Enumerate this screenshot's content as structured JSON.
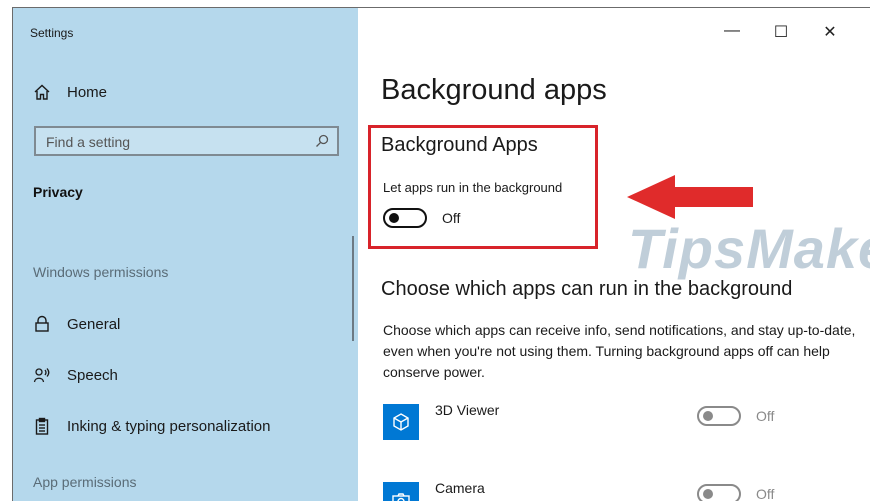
{
  "window": {
    "title": "Settings",
    "controls": {
      "minimize": "—",
      "maximize": "☐",
      "close": "✕"
    }
  },
  "sidebar": {
    "home_label": "Home",
    "search_placeholder": "Find a setting",
    "current_section": "Privacy",
    "windows_permissions_label": "Windows permissions",
    "items": [
      {
        "label": "General",
        "icon": "lock-icon"
      },
      {
        "label": "Speech",
        "icon": "speech-icon"
      },
      {
        "label": "Inking & typing personalization",
        "icon": "clipboard-icon"
      }
    ],
    "app_permissions_label": "App permissions"
  },
  "main": {
    "page_title": "Background apps",
    "section_title": "Background Apps",
    "toggle_label": "Let apps run in the background",
    "toggle_state": "Off",
    "choose_title": "Choose which apps can run in the background",
    "choose_description": "Choose which apps can receive info, send notifications, and stay up-to-date, even when you're not using them. Turning background apps off can help conserve power.",
    "apps": [
      {
        "name": "3D Viewer",
        "state": "Off",
        "icon": "cube-icon"
      },
      {
        "name": "Camera",
        "state": "Off",
        "icon": "camera-icon"
      }
    ]
  },
  "watermark": "TipsMake",
  "colors": {
    "sidebar_bg": "#b5d8ec",
    "highlight": "#d8232a",
    "app_icon_bg": "#0078d4"
  }
}
